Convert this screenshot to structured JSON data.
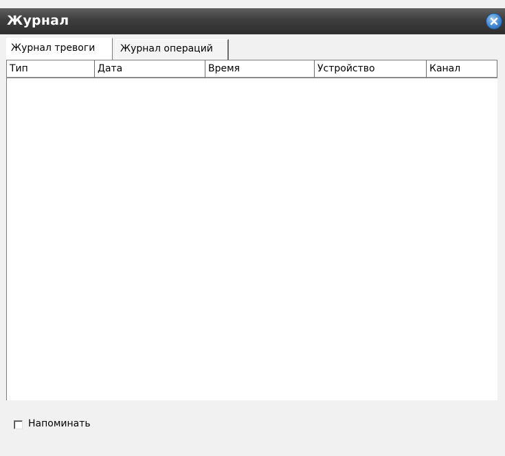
{
  "window": {
    "title": "Журнал"
  },
  "tabs": [
    {
      "label": "Журнал тревоги",
      "active": true
    },
    {
      "label": "Журнал операций",
      "active": false
    }
  ],
  "table": {
    "columns": [
      "Тип",
      "Дата",
      "Время",
      "Устройство",
      "Канал"
    ],
    "rows": []
  },
  "footer": {
    "remind_label": "Напоминать",
    "remind_checked": false
  },
  "colors": {
    "titlebar": "#3d3d3d",
    "close_button": "#3f86cf",
    "background": "#f1f1f1"
  }
}
